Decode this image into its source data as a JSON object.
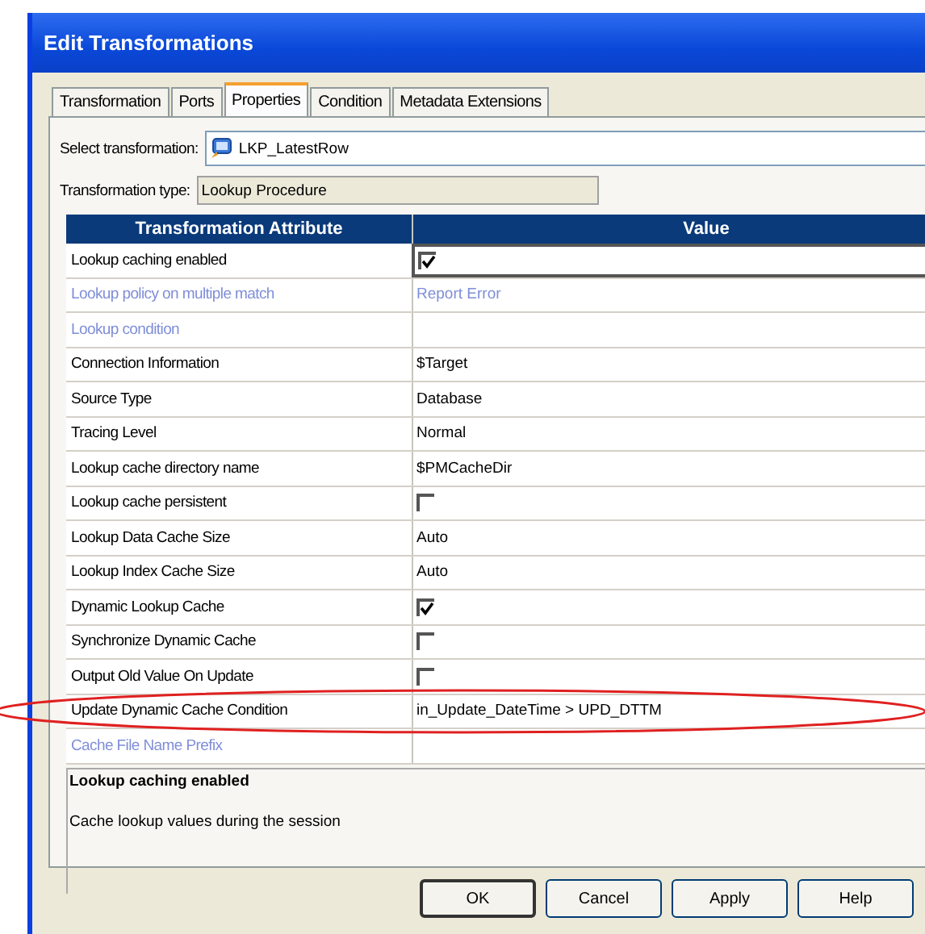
{
  "window": {
    "title": "Edit Transformations"
  },
  "tabs": [
    {
      "label": "Transformation",
      "selected": false
    },
    {
      "label": "Ports",
      "selected": false
    },
    {
      "label": "Properties",
      "selected": true
    },
    {
      "label": "Condition",
      "selected": false
    },
    {
      "label": "Metadata Extensions",
      "selected": false
    }
  ],
  "select_transformation": {
    "label": "Select transformation:",
    "value": "LKP_LatestRow"
  },
  "transformation_type": {
    "label": "Transformation type:",
    "value": "Lookup Procedure"
  },
  "table": {
    "columns": [
      "Transformation Attribute",
      "Value"
    ],
    "rows": [
      {
        "attribute": "Lookup caching enabled",
        "kind": "check",
        "checked": true,
        "disabled": false,
        "selected": true
      },
      {
        "attribute": "Lookup policy on multiple match",
        "kind": "text",
        "value": "Report Error",
        "disabled": true,
        "selected": false
      },
      {
        "attribute": "Lookup condition",
        "kind": "text",
        "disabled": true,
        "selected": false
      },
      {
        "attribute": "Connection Information",
        "kind": "text",
        "value": "$Target",
        "disabled": false,
        "selected": false
      },
      {
        "attribute": "Source Type",
        "kind": "text",
        "value": "Database",
        "disabled": false,
        "selected": false
      },
      {
        "attribute": "Tracing Level",
        "kind": "text",
        "value": "Normal",
        "disabled": false,
        "selected": false
      },
      {
        "attribute": "Lookup cache directory name",
        "kind": "text",
        "value": "$PMCacheDir",
        "disabled": false,
        "selected": false
      },
      {
        "attribute": "Lookup cache persistent",
        "kind": "check",
        "checked": false,
        "disabled": false,
        "selected": false
      },
      {
        "attribute": "Lookup Data Cache Size",
        "kind": "text",
        "value": "Auto",
        "disabled": false,
        "selected": false
      },
      {
        "attribute": "Lookup Index Cache Size",
        "kind": "text",
        "value": "Auto",
        "disabled": false,
        "selected": false
      },
      {
        "attribute": "Dynamic Lookup Cache",
        "kind": "check",
        "checked": true,
        "disabled": false,
        "selected": false
      },
      {
        "attribute": "Synchronize Dynamic Cache",
        "kind": "check",
        "checked": false,
        "disabled": false,
        "selected": false
      },
      {
        "attribute": "Output Old Value On Update",
        "kind": "check",
        "checked": false,
        "disabled": false,
        "selected": false
      },
      {
        "attribute": "Update Dynamic Cache Condition",
        "kind": "text",
        "value": "in_Update_DateTime > UPD_DTTM",
        "disabled": false,
        "selected": false
      },
      {
        "attribute": "Cache File Name Prefix",
        "kind": "text",
        "disabled": true,
        "selected": false
      }
    ]
  },
  "description": {
    "title": "Lookup caching enabled",
    "text": "Cache lookup values during the session"
  },
  "buttons": [
    "OK",
    "Cancel",
    "Apply",
    "Help"
  ]
}
